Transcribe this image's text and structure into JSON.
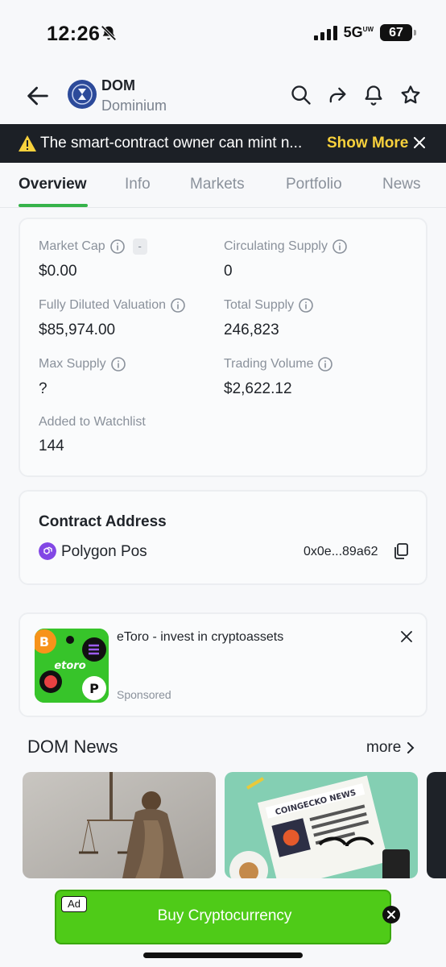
{
  "status": {
    "time": "12:26",
    "network": "5G",
    "network_sup": "UW",
    "battery": "67"
  },
  "header": {
    "symbol": "DOM",
    "name": "Dominium"
  },
  "warning": {
    "text": "The smart-contract owner can mint n...",
    "action": "Show More"
  },
  "tabs": [
    {
      "label": "Overview",
      "active": true
    },
    {
      "label": "Info"
    },
    {
      "label": "Markets"
    },
    {
      "label": "Portfolio"
    },
    {
      "label": "News"
    }
  ],
  "stats": {
    "market_cap": {
      "label": "Market Cap",
      "value": "$0.00",
      "badge": "-"
    },
    "circulating_supply": {
      "label": "Circulating Supply",
      "value": "0"
    },
    "fdv": {
      "label": "Fully Diluted Valuation",
      "value": "$85,974.00"
    },
    "total_supply": {
      "label": "Total Supply",
      "value": "246,823"
    },
    "max_supply": {
      "label": "Max Supply",
      "value": "?"
    },
    "trading_volume": {
      "label": "Trading Volume",
      "value": "$2,622.12"
    },
    "watchlist": {
      "label": "Added to Watchlist",
      "value": "144"
    }
  },
  "contract": {
    "title": "Contract Address",
    "chain": "Polygon Pos",
    "address": "0x0e...89a62"
  },
  "sponsored_ad": {
    "title": "eToro - invest in cryptoassets",
    "sponsored": "Sponsored",
    "logo_text": "etoro"
  },
  "news": {
    "title": "DOM News",
    "more": "more"
  },
  "ad_bar": {
    "tag": "Ad",
    "label": "Buy Cryptocurrency"
  },
  "colors": {
    "accent": "#36b34a",
    "warning_bg": "#1c2026",
    "warning_action": "#f8d13c",
    "ad_green": "#4fcb18",
    "polygon": "#8247e5"
  }
}
